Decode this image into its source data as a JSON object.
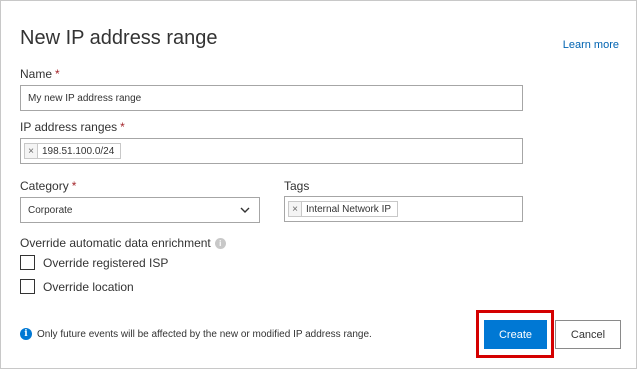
{
  "dialog": {
    "title": "New IP address range",
    "learn_more": "Learn more"
  },
  "form": {
    "name": {
      "label": "Name",
      "required_mark": "*",
      "value": "My new IP address range"
    },
    "ip_ranges": {
      "label": "IP address ranges",
      "required_mark": "*",
      "chips": [
        "198.51.100.0/24"
      ]
    },
    "category": {
      "label": "Category",
      "required_mark": "*",
      "selected": "Corporate"
    },
    "tags": {
      "label": "Tags",
      "chips": [
        "Internal Network IP"
      ]
    },
    "override": {
      "label": "Override automatic data enrichment",
      "options": [
        {
          "label": "Override registered ISP",
          "checked": false
        },
        {
          "label": "Override location",
          "checked": false
        }
      ]
    }
  },
  "footer": {
    "note": "Only future events will be affected by the new or modified IP address range.",
    "create_label": "Create",
    "cancel_label": "Cancel"
  },
  "chip_remove_glyph": "×",
  "colors": {
    "accent": "#0078d4",
    "link": "#0063b1",
    "highlight": "#d40000"
  }
}
